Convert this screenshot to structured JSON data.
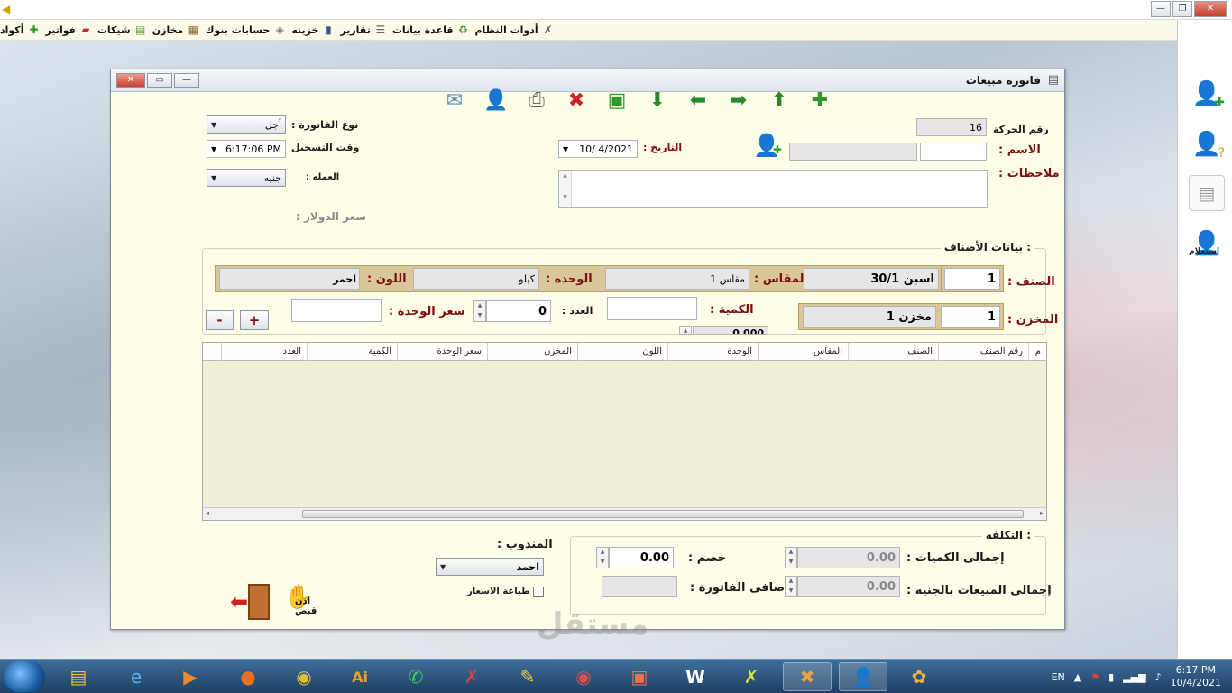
{
  "menu": {
    "items": [
      {
        "label": "أكواد",
        "icon": "plus-icon"
      },
      {
        "label": "فواتير",
        "icon": "invoice-icon"
      },
      {
        "label": "شيكات",
        "icon": "cheque-icon"
      },
      {
        "label": "مخازن",
        "icon": "warehouse-icon"
      },
      {
        "label": "حسابات بنوك",
        "icon": "bank-icon"
      },
      {
        "label": "خزينه",
        "icon": "safe-icon"
      },
      {
        "label": "تقارير",
        "icon": "report-icon"
      },
      {
        "label": "قاعدة بيانات",
        "icon": "database-icon"
      },
      {
        "label": "أدوات النظام",
        "icon": "tools-icon"
      }
    ]
  },
  "dialog": {
    "title": "فاتورة مبيعات"
  },
  "header": {
    "invoice_type_label": "نوع الفاتورة :",
    "invoice_type_value": "أجل",
    "record_time_label": "وقت التسجيل",
    "record_time_value": "6:17:06 PM",
    "currency_label": "العمله :",
    "currency_value": "جنيه",
    "dollar_rate_label": "سعر الدولار :",
    "movement_no_label": "رقم الحركة",
    "movement_no_value": "16",
    "name_label": "الاسم :",
    "date_label": "التاريخ :",
    "date_value": "10/  4/2021",
    "notes_label": "ملاحظات :"
  },
  "items_section": {
    "title": "بيانات الأصناف :",
    "item_label": "الصنف :",
    "item_code": "1",
    "item_name": "اسبن 30/1",
    "size_label": "المقاس :",
    "size_value": "مقاس 1",
    "unit_label": "الوحده :",
    "unit_value": "كيلو",
    "color_label": "اللون :",
    "color_value": "احمر",
    "store_label": "المخزن :",
    "store_code": "1",
    "store_name": "مخزن 1",
    "quantity_label": "الكمية :",
    "count_label": "العدد :",
    "count_value": "0",
    "unit_price_label": "سعر الوحدة :",
    "qty_readout": "0.000",
    "add_label": "+",
    "remove_label": "-"
  },
  "grid": {
    "columns": [
      "م",
      "رقم الصنف",
      "الصنف",
      "المقاس",
      "الوحدة",
      "اللون",
      "المخزن",
      "سعر الوحدة",
      "الكمية",
      "العدد"
    ]
  },
  "cost": {
    "title": "التكلفه :",
    "total_qty_label": "إجمالى الكميات :",
    "total_qty_value": "0.00",
    "discount_label": "خصم :",
    "discount_value": "0.00",
    "total_sales_label": "إجمالى المبيعات بالجنيه :",
    "total_sales_value": "0.00",
    "net_label": "صافى الفاتورة :"
  },
  "footer": {
    "rep_label": "المندوب :",
    "rep_value": "احمد",
    "print_prices_label": "طباعة الاسعار",
    "receipt_label": "اذن قبض"
  },
  "taskbar": {
    "lang": "EN",
    "time": "6:17 PM",
    "date": "10/4/2021"
  },
  "watermark": "مستقل",
  "sidebar_label": "استعلام"
}
